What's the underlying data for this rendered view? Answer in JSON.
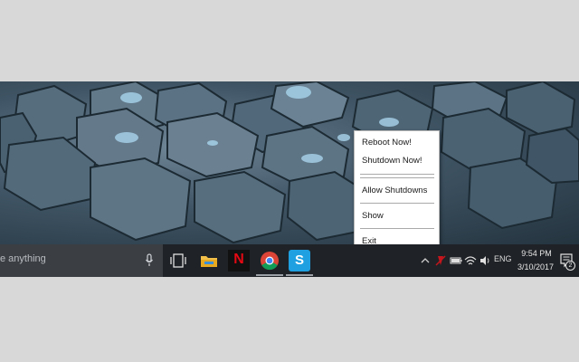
{
  "tray_menu": {
    "items": [
      {
        "label": "Reboot Now!"
      },
      {
        "label": "Shutdown Now!"
      },
      {
        "label": "Allow Shutdowns"
      },
      {
        "label": "Show"
      },
      {
        "label": "Exit"
      }
    ]
  },
  "taskbar": {
    "search": {
      "placeholder": "e anything"
    },
    "pinned_icons": [
      "task-view-icon",
      "file-explorer-icon",
      "netflix-icon",
      "chrome-icon",
      "skype-icon"
    ],
    "netflix_letter": "N",
    "skype_letter": "S",
    "tray": {
      "icons": [
        "chevron-up-icon",
        "app-tray-icon",
        "battery-icon",
        "wifi-icon",
        "volume-icon"
      ],
      "language": "ENG",
      "time": "9:54 PM",
      "date": "3/10/2017",
      "notification_count": "2"
    }
  },
  "colors": {
    "taskbar": "#1f2226",
    "search_box": "#3b3f44",
    "netflix_red": "#e50914",
    "skype_blue": "#1fa0e0",
    "folder_yellow": "#f2c04a"
  }
}
